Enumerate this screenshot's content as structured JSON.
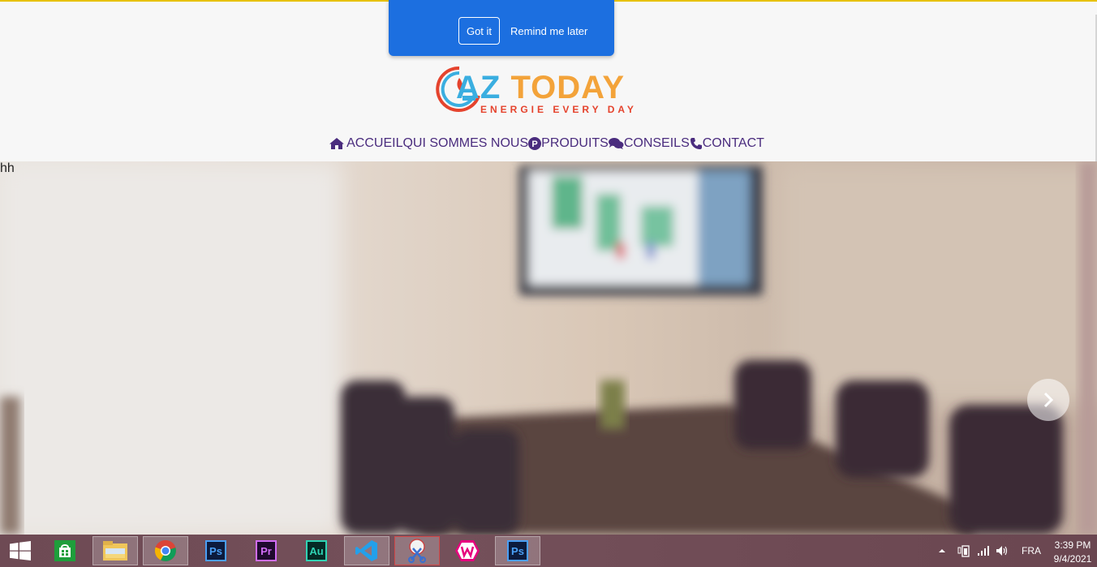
{
  "notification": {
    "got_it": "Got it",
    "remind_later": "Remind me later"
  },
  "logo": {
    "main_a": "AZ",
    "main_b": "TODAY",
    "tagline": "ENERGIE EVERY DAY"
  },
  "nav": {
    "items": [
      {
        "label": "ACCUEIL",
        "icon": "home-icon"
      },
      {
        "label": "QUI SOMMES NOUS",
        "icon": ""
      },
      {
        "label": "PRODUITS",
        "icon": "p-circle-icon"
      },
      {
        "label": " CONSEILS",
        "icon": "comments-icon"
      },
      {
        "label": "CONTACT",
        "icon": "phone-icon"
      }
    ]
  },
  "hero": {
    "stray_text": "hh"
  },
  "taskbar": {
    "apps": [
      {
        "name": "start-button",
        "label": ""
      },
      {
        "name": "store",
        "label": ""
      },
      {
        "name": "file-explorer",
        "label": ""
      },
      {
        "name": "chrome",
        "label": ""
      },
      {
        "name": "photoshop",
        "label": "Ps"
      },
      {
        "name": "premiere",
        "label": "Pr"
      },
      {
        "name": "audition",
        "label": "Au"
      },
      {
        "name": "vscode",
        "label": ""
      },
      {
        "name": "snipping-tool",
        "label": ""
      },
      {
        "name": "wamp",
        "label": ""
      },
      {
        "name": "photoshop-2",
        "label": "Ps"
      }
    ],
    "language": "FRA",
    "time": "3:39 PM",
    "date": "9/4/2021"
  },
  "colors": {
    "notification_bg": "#1c6fe0",
    "nav_text": "#4a2c7e",
    "logo_blue": "#3aaee0",
    "logo_orange": "#f3a33a",
    "logo_red": "#e5432d",
    "taskbar_bg": "#6e4a54"
  }
}
